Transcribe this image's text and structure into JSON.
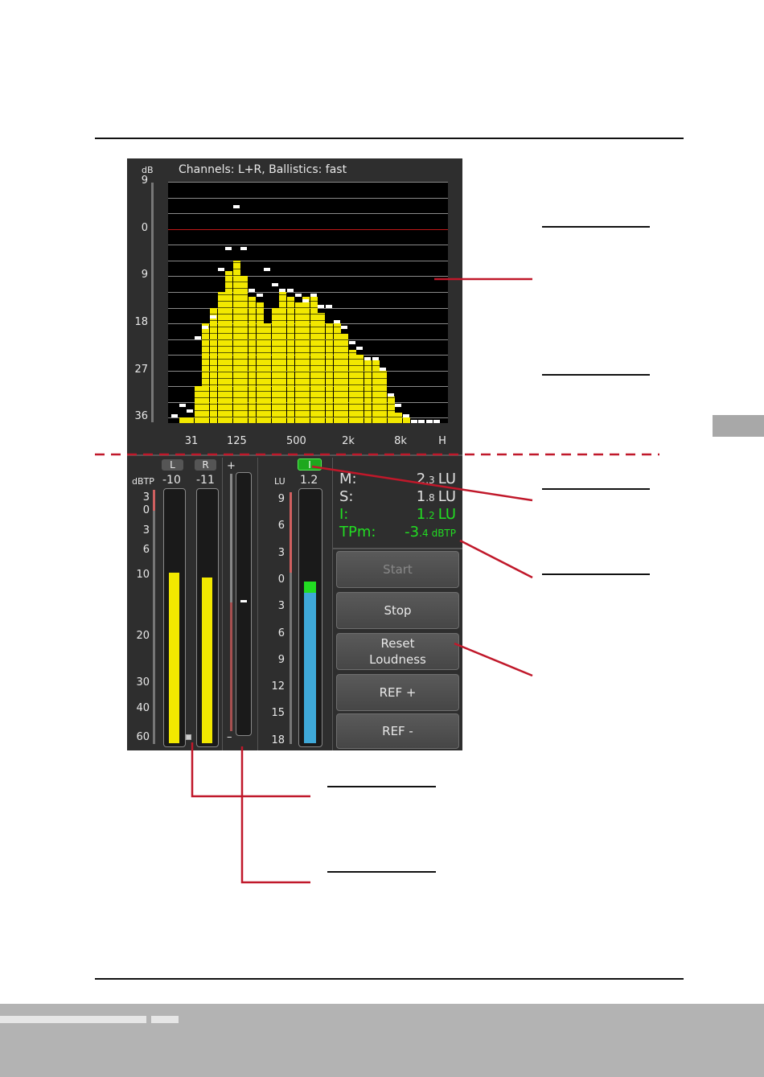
{
  "spectrum": {
    "header": "Channels: L+R, Ballistics: fast",
    "unit": "dB",
    "y_ticks": [
      "9",
      "0",
      "9",
      "18",
      "27",
      "36"
    ],
    "x_ticks": [
      "31",
      "125",
      "500",
      "2k",
      "8k",
      "H"
    ]
  },
  "chart_data": {
    "type": "bar",
    "title": "Channels: L+R, Ballistics: fast",
    "ylabel": "dB",
    "y_tick_labels": [
      "9",
      "0",
      "9",
      "18",
      "27",
      "36"
    ],
    "x_tick_labels": [
      "31",
      "125",
      "500",
      "2k",
      "8k",
      "H"
    ],
    "ylim": [
      -37,
      9
    ],
    "levels_db": [
      -37,
      -36,
      -36,
      -30,
      -18,
      -15,
      -12,
      -8,
      -6,
      -9,
      -13,
      -14,
      -18,
      -15,
      -12,
      -13,
      -14,
      -13,
      -13,
      -16,
      -18,
      -18,
      -20,
      -23,
      -24,
      -25,
      -25,
      -27,
      -32,
      -35,
      -36,
      -37,
      -37,
      -37,
      -37
    ],
    "peaks_db": [
      -36,
      -34,
      -35,
      -21,
      -19,
      -17,
      -8,
      -4,
      4,
      -4,
      -12,
      -13,
      -8,
      -11,
      -12,
      -12,
      -13,
      -14,
      -13,
      -15,
      -15,
      -18,
      -19,
      -22,
      -23,
      -25,
      -25,
      -27,
      -32,
      -34,
      -36,
      -37,
      -37,
      -37,
      -37
    ],
    "reference_line_db": 0,
    "colors": {
      "bars": "#f2e800",
      "peaks": "#ffffff",
      "reference": "#c01818",
      "background": "#000000"
    }
  },
  "ppm": {
    "unit": "dBTP",
    "left_label": "L",
    "right_label": "R",
    "left_value": "-10",
    "right_value": "-11",
    "scale": [
      "3",
      "0",
      "3",
      "6",
      "10",
      "20",
      "30",
      "40",
      "60"
    ],
    "left_level_fraction": 0.68,
    "right_level_fraction": 0.66,
    "bar_color": "#f2e800"
  },
  "correlation": {
    "plus": "+",
    "minus": "–"
  },
  "lu_meter": {
    "badge": "I",
    "unit": "LU",
    "value": "1.2",
    "scale": [
      "9",
      "6",
      "3",
      "0",
      "3",
      "6",
      "9",
      "12",
      "15",
      "18"
    ],
    "level_fraction": 0.645,
    "bar_color": "#3fa9d9",
    "top_color": "#22dd22"
  },
  "readouts": [
    {
      "key": "M:",
      "big": "2",
      "small": ".3",
      "unit": "LU",
      "color": "#e0e0e0"
    },
    {
      "key": "S:",
      "big": "1",
      "small": ".8",
      "unit": "LU",
      "color": "#e0e0e0"
    },
    {
      "key": "I:",
      "big": "1",
      "small": ".2",
      "unit": "LU",
      "color": "#22dd22"
    },
    {
      "key": "TPm:",
      "big": "-3",
      "small": ".4",
      "unit": "dBTP",
      "color": "#22dd22"
    }
  ],
  "buttons": {
    "start": "Start",
    "stop": "Stop",
    "reset_line1": "Reset",
    "reset_line2": "Loudness",
    "ref_plus": "REF +",
    "ref_minus": "REF -"
  }
}
